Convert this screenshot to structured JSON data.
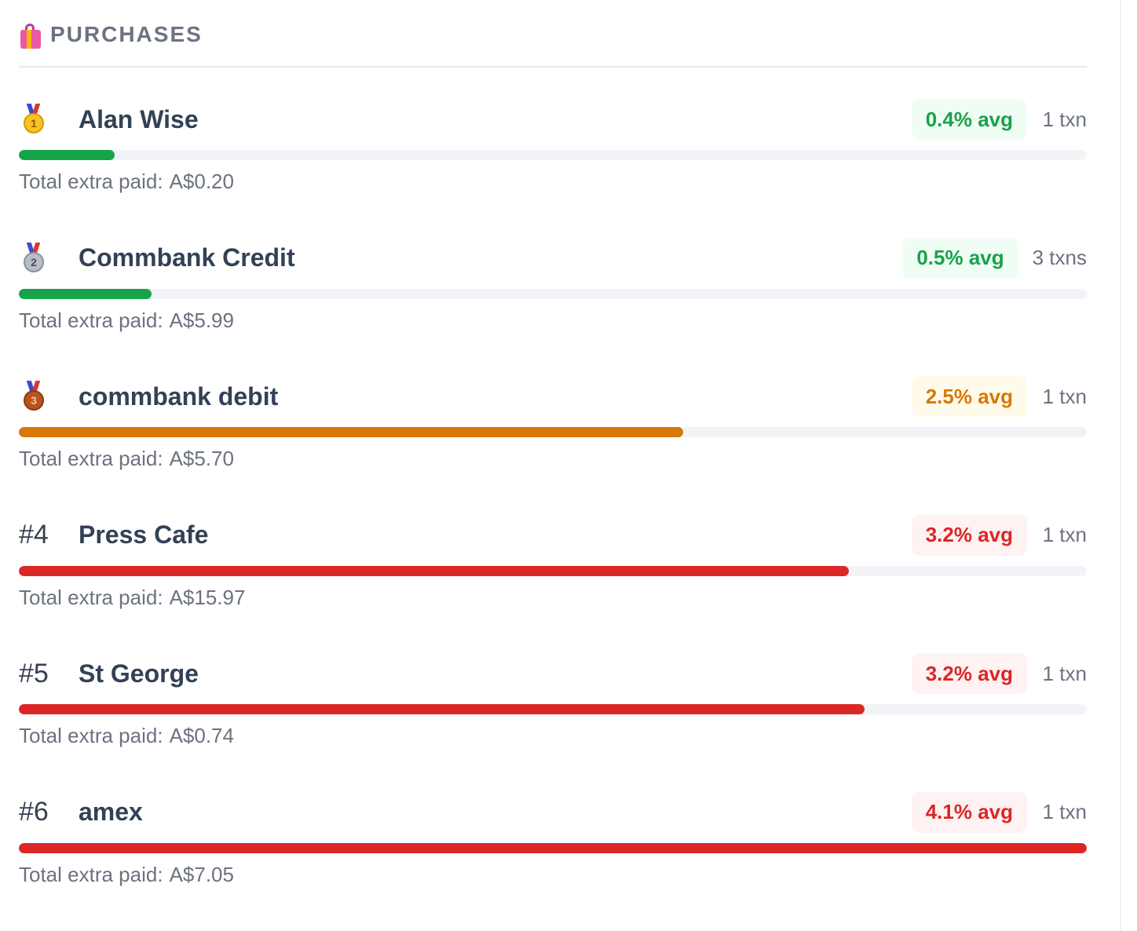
{
  "header": {
    "title": "PURCHASES",
    "icon": "shopping-bags-icon"
  },
  "colors": {
    "green": "#16a34a",
    "green_bg": "#f0fdf4",
    "orange": "#d97706",
    "orange_bg": "#fffbeb",
    "red": "#dc2626",
    "red_bg": "#fef2f2",
    "track": "#f1f3f7"
  },
  "rows": [
    {
      "rank": "",
      "medal": "gold",
      "medal_num": "1",
      "name": "Alan Wise",
      "avg": "0.4% avg",
      "txn": "1 txn",
      "total_label": "Total extra paid:",
      "total_value": "A$0.20",
      "fill": 0.09,
      "tone": "green"
    },
    {
      "rank": "",
      "medal": "silver",
      "medal_num": "2",
      "name": "Commbank Credit",
      "avg": "0.5% avg",
      "txn": "3 txns",
      "total_label": "Total extra paid:",
      "total_value": "A$5.99",
      "fill": 0.124,
      "tone": "green"
    },
    {
      "rank": "",
      "medal": "bronze",
      "medal_num": "3",
      "name": "commbank debit",
      "avg": "2.5% avg",
      "txn": "1 txn",
      "total_label": "Total extra paid:",
      "total_value": "A$5.70",
      "fill": 0.622,
      "tone": "orange"
    },
    {
      "rank": "#4",
      "medal": "",
      "medal_num": "",
      "name": "Press Cafe",
      "avg": "3.2% avg",
      "txn": "1 txn",
      "total_label": "Total extra paid:",
      "total_value": "A$15.97",
      "fill": 0.777,
      "tone": "red"
    },
    {
      "rank": "#5",
      "medal": "",
      "medal_num": "",
      "name": "St George",
      "avg": "3.2% avg",
      "txn": "1 txn",
      "total_label": "Total extra paid:",
      "total_value": "A$0.74",
      "fill": 0.792,
      "tone": "red"
    },
    {
      "rank": "#6",
      "medal": "",
      "medal_num": "",
      "name": "amex",
      "avg": "4.1% avg",
      "txn": "1 txn",
      "total_label": "Total extra paid:",
      "total_value": "A$7.05",
      "fill": 1.0,
      "tone": "red"
    }
  ]
}
